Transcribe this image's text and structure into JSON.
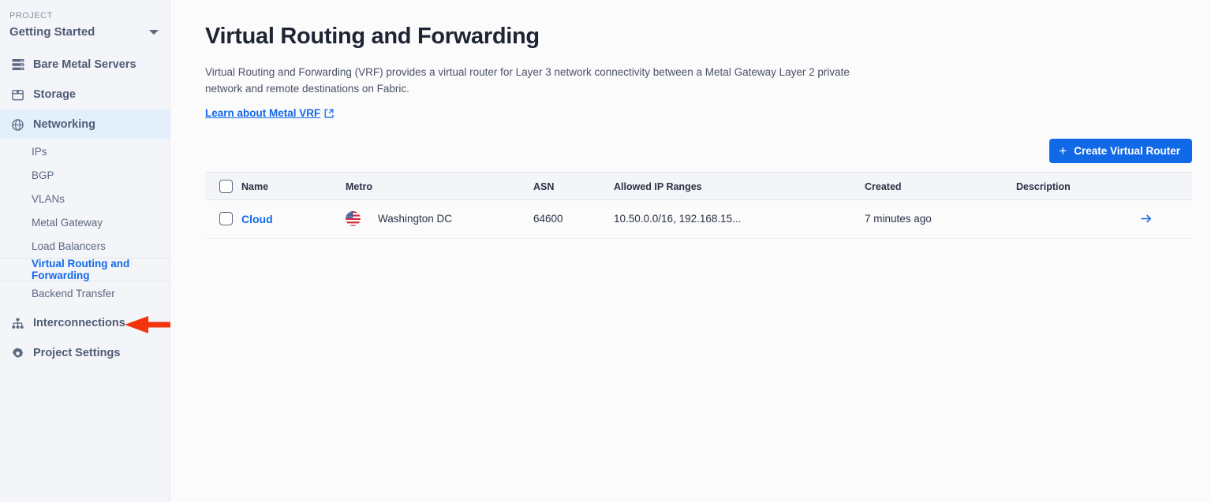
{
  "sidebar": {
    "project_label": "PROJECT",
    "project_name": "Getting Started",
    "caret_icon": "chevron-down-icon",
    "items": [
      {
        "label": "Bare Metal Servers",
        "icon": "server-rack-icon"
      },
      {
        "label": "Storage",
        "icon": "storage-box-icon"
      },
      {
        "label": "Networking",
        "icon": "globe-network-icon"
      }
    ],
    "subitems": [
      {
        "label": "IPs"
      },
      {
        "label": "BGP"
      },
      {
        "label": "VLANs"
      },
      {
        "label": "Metal Gateway"
      },
      {
        "label": "Load Balancers"
      },
      {
        "label": "Virtual Routing and Forwarding"
      },
      {
        "label": "Backend Transfer"
      }
    ],
    "bottom_items": [
      {
        "label": "Interconnections",
        "icon": "sitemap-icon"
      },
      {
        "label": "Project Settings",
        "icon": "gear-icon"
      }
    ]
  },
  "annotation": {
    "arrow_color": "#F4340C",
    "target": "Interconnections"
  },
  "main": {
    "title": "Virtual Routing and Forwarding",
    "description": "Virtual Routing and Forwarding (VRF) provides a virtual router for Layer 3 network connectivity between a Metal Gateway Layer 2 private network and remote destinations on Fabric.",
    "learn_link": "Learn about Metal VRF",
    "learn_link_icon": "external-link-icon",
    "create_button": "Create Virtual Router",
    "create_button_icon": "plus-icon",
    "create_button_color": "#1269E8"
  },
  "table": {
    "columns": [
      "Name",
      "Metro",
      "ASN",
      "Allowed IP Ranges",
      "Created",
      "Description"
    ],
    "rows": [
      {
        "name": "Cloud",
        "metro": "Washington DC",
        "metro_flag": "us-flag-icon",
        "asn": "64600",
        "allowed_ip_ranges": "10.50.0.0/16, 192.168.15...",
        "created": "7 minutes ago",
        "description": "",
        "go_icon": "arrow-right-icon"
      }
    ]
  }
}
